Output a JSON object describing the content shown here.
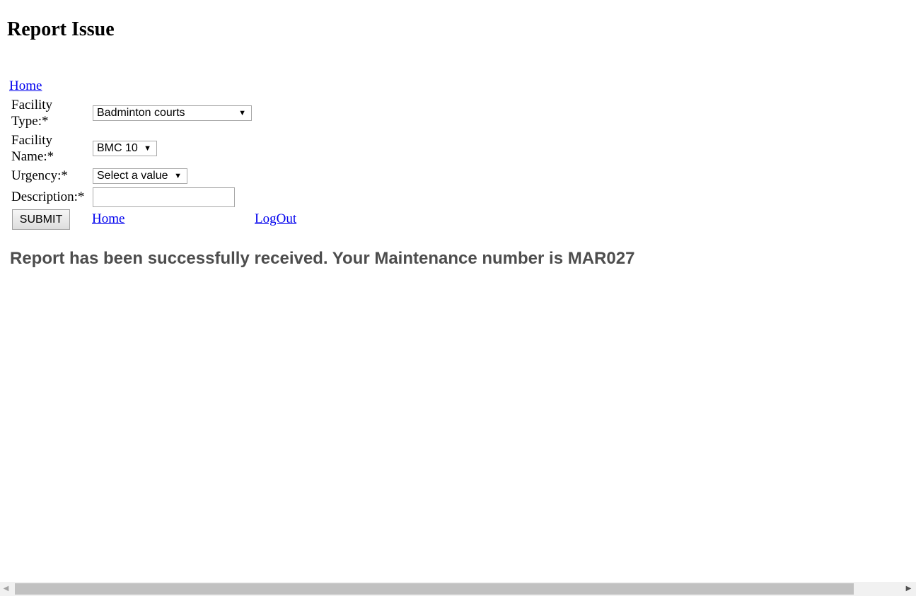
{
  "page": {
    "title": "Report Issue"
  },
  "nav": {
    "home_top": "Home",
    "home_bottom": "Home",
    "logout": "LogOut"
  },
  "form": {
    "facility_type": {
      "label_line1": "Facility",
      "label_line2": "Type:*",
      "value": "Badminton courts"
    },
    "facility_name": {
      "label_line1": "Facility",
      "label_line2": "Name:*",
      "value": "BMC 10"
    },
    "urgency": {
      "label": "Urgency:*",
      "value": "Select a value"
    },
    "description": {
      "label": "Description:*",
      "value": ""
    },
    "submit_label": "SUBMIT"
  },
  "message": "Report has been successfully received. Your Maintenance number is MAR027",
  "icons": {
    "dropdown": "▼",
    "scroll_left": "◀",
    "scroll_right": "▶"
  }
}
